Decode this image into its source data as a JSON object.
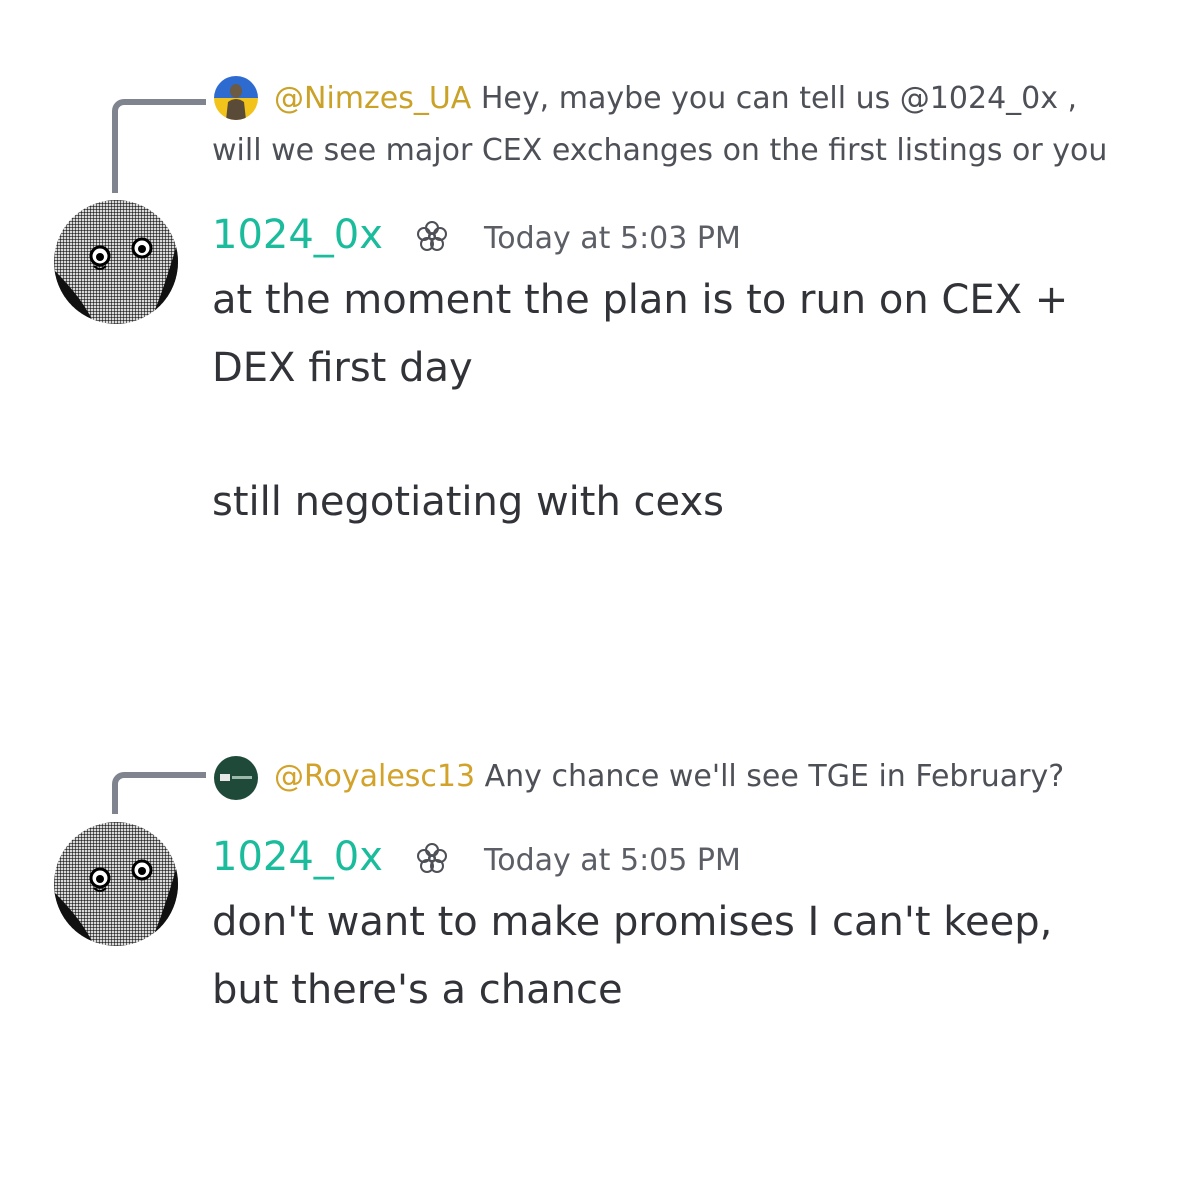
{
  "messages": [
    {
      "reply": {
        "author": "@Nimzes_UA",
        "text_line1": "Hey, maybe you can tell us @1024_0x ,",
        "text_line2": "will we see major CEX exchanges on the first listings or you",
        "avatar_icon": "reply-avatar-figure-icon"
      },
      "author": "1024_0x",
      "badge_icon": "flower-badge-icon",
      "timestamp": "Today at 5:03 PM",
      "lines": [
        "at the moment the plan is to run on CEX +",
        "DEX first day",
        "",
        "still negotiating with cexs"
      ]
    },
    {
      "reply": {
        "author": "@Royalesc13",
        "text_line1": "Any chance we'll see TGE in February?",
        "avatar_icon": "reply-avatar-dark-green-icon"
      },
      "author": "1024_0x",
      "badge_icon": "flower-badge-icon",
      "timestamp": "Today at 5:05 PM",
      "lines": [
        "don't want to make promises I can't keep,",
        "but there's a chance"
      ]
    }
  ],
  "colors": {
    "username": "#1abc9c",
    "reply_author": "#c9a227",
    "reply_connector": "#80848e",
    "body_text": "#313338"
  }
}
